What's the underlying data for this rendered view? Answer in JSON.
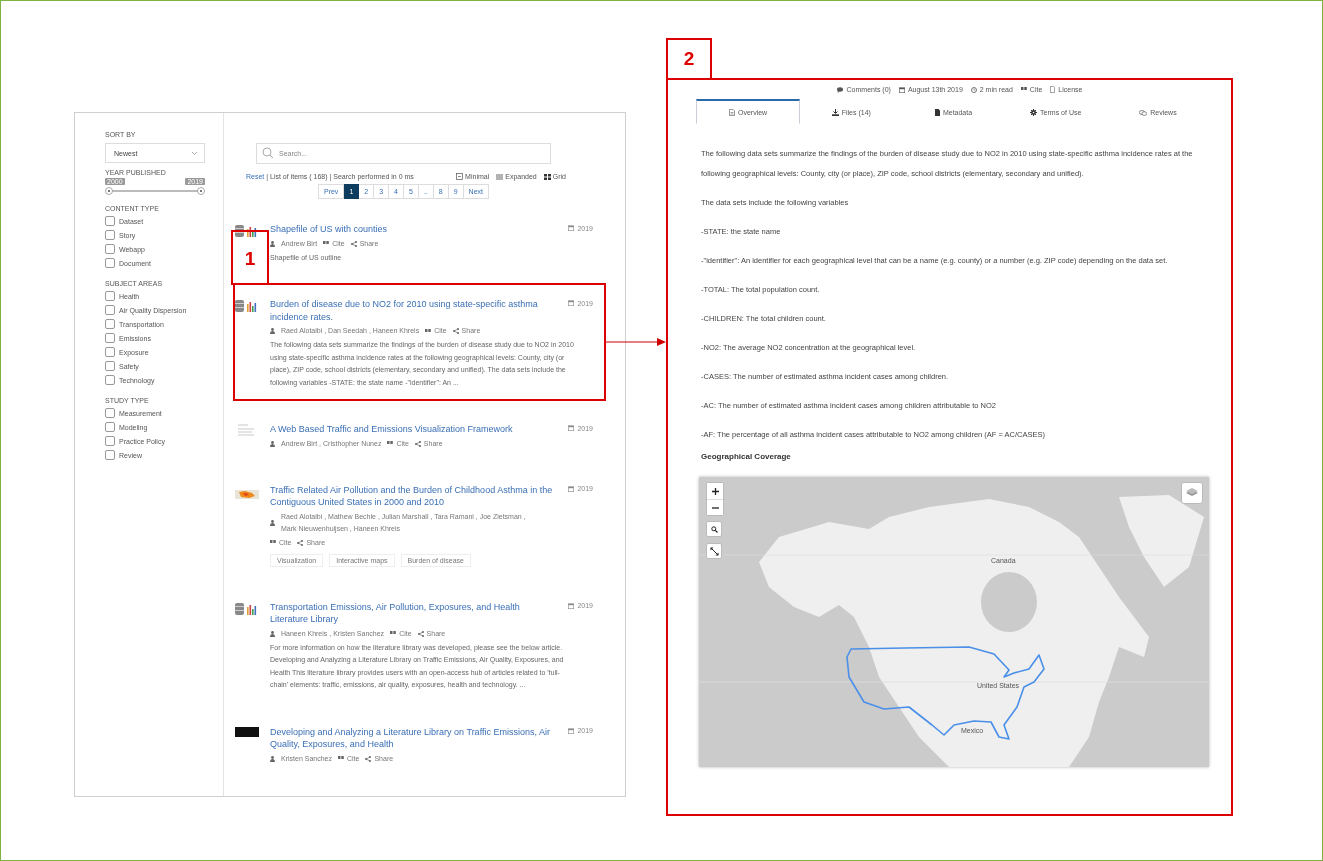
{
  "callouts": [
    {
      "label": "1"
    },
    {
      "label": "2"
    }
  ],
  "search_page": {
    "sidebar": {
      "sort_label": "SORT BY",
      "sort_value": "Newest",
      "year_label": "YEAR PUBLISHED",
      "year_from": "2000",
      "year_to": "2019",
      "year_range": {
        "level": 1
      },
      "groups": [
        {
          "title": "CONTENT TYPE",
          "options": [
            {
              "label": "Dataset",
              "checked": false
            },
            {
              "label": "Story",
              "checked": false
            },
            {
              "label": "Webapp",
              "checked": false
            },
            {
              "label": "Document",
              "checked": false
            }
          ]
        },
        {
          "title": "SUBJECT AREAS",
          "options": [
            {
              "label": "Health",
              "checked": false
            },
            {
              "label": "Air Quality Dispersion",
              "checked": false
            },
            {
              "label": "Transportation",
              "checked": false
            },
            {
              "label": "Emissions",
              "checked": false
            },
            {
              "label": "Exposure",
              "checked": false
            },
            {
              "label": "Safety",
              "checked": false
            },
            {
              "label": "Technology",
              "checked": false
            }
          ]
        },
        {
          "title": "STUDY TYPE",
          "options": [
            {
              "label": "Measurement",
              "checked": false
            },
            {
              "label": "Modeling",
              "checked": false
            },
            {
              "label": "Practice Policy",
              "checked": false
            },
            {
              "label": "Review",
              "checked": false
            }
          ]
        }
      ]
    },
    "search": {
      "placeholder": "Search..."
    },
    "info": {
      "reset": "Reset",
      "summary": "| List of items ( 168) | Search performed in 0 ms"
    },
    "views": [
      {
        "kind": "minimal",
        "label": "Minimal"
      },
      {
        "kind": "expanded",
        "label": "Expanded"
      },
      {
        "kind": "grid",
        "label": "Grid"
      }
    ],
    "pagination": [
      {
        "label": "Prev",
        "selected": false
      },
      {
        "label": "1",
        "selected": true
      },
      {
        "label": "2",
        "selected": false
      },
      {
        "label": "3",
        "selected": false
      },
      {
        "label": "4",
        "selected": false
      },
      {
        "label": "5",
        "selected": false
      },
      {
        "label": "..",
        "selected": false
      },
      {
        "label": "8",
        "selected": false
      },
      {
        "label": "9",
        "selected": false
      },
      {
        "label": "Next",
        "selected": false
      }
    ],
    "results": [
      {
        "kind": "database",
        "title": "Shapefile of US with counties",
        "year": "2019",
        "authors": "Andrew Birt",
        "cite": "Cite",
        "share": "Share",
        "description": "Shapefile of US outline"
      },
      {
        "kind": "database",
        "title": "Burden of disease due to NO2 for 2010 using state-specific asthma incidence rates.",
        "year": "2019",
        "authors": "Raed Alotaibi , Dan Seedah , Haneen Khreis",
        "cite": "Cite",
        "share": "Share",
        "description": "The following data sets summarize the findings of the burden of disease study due to NO2 in 2010 using state-specific asthma incidence rates at the following geographical levels: County, city (or place), ZIP code, school districts (elementary, secondary and unified). The data sets include the following variables -STATE: the state name -\"identifier\": An ..."
      },
      {
        "kind": "document",
        "title": "A Web Based Traffic and Emissions Visualization Framework",
        "year": "2019",
        "authors": "Andrew Birt , Cristhopher Nunez",
        "cite": "Cite",
        "share": "Share"
      },
      {
        "kind": "map",
        "title": "Traffic Related Air Pollution and the Burden of Childhood Asthma in the Contiguous United States in 2000 and 2010",
        "year": "2019",
        "authors": "Raed Alotaibi , Mathew Bechle , Julian Marshall , Tara Ramani , Joe Zietsman , Mark Nieuwenhuijsen , Haneen Khreis",
        "cite": "Cite",
        "share": "Share",
        "tags": [
          "Visualization",
          "Interactive maps",
          "Burden of disease"
        ]
      },
      {
        "kind": "database",
        "title": "Transportation Emissions, Air Pollution, Exposures, and Health Literature Library",
        "year": "2019",
        "authors": "Haneen Khreis , Kristen Sanchez",
        "cite": "Cite",
        "share": "Share",
        "description": "For more information on how the literature library was developed, please see the below article. Developing and Analyzing a Literature Library on Traffic Emissions, Air Quality, Exposures, and Health This literature library provides users with an open-access hub of articles related to 'full-chain' elements: traffic, emissions, air quality, exposures, health and technology. ..."
      },
      {
        "kind": "photo",
        "title": "Developing and Analyzing a Literature Library on Traffic Emissions, Air Quality, Exposures, and Health",
        "year": "2019",
        "authors": "Kristen Sanchez",
        "cite": "Cite",
        "share": "Share"
      }
    ]
  },
  "detail_page": {
    "meta": [
      {
        "kind": "comments",
        "text": "Comments (0)"
      },
      {
        "kind": "calendar",
        "text": "August 13th 2019"
      },
      {
        "kind": "clock",
        "text": "2 min read"
      },
      {
        "kind": "quote",
        "text": "Cite"
      },
      {
        "kind": "document",
        "text": "License"
      }
    ],
    "tabs": [
      {
        "kind": "document",
        "label": "Overview",
        "selected": true
      },
      {
        "kind": "download",
        "label": "Files (14)",
        "selected": false
      },
      {
        "kind": "file",
        "label": "Metadata",
        "selected": false
      },
      {
        "kind": "gear",
        "label": "Terms of Use",
        "selected": false
      },
      {
        "kind": "comments",
        "label": "Reviews",
        "selected": false
      }
    ],
    "paragraphs": [
      {
        "kind": "text",
        "text": "The following data sets summarize the findings of the burden of disease study due to NO2 in 2010 using state-specific asthma incidence rates at the following geographical levels: County, city (or place), ZIP code, school districts (elementary, secondary and unified)."
      },
      {
        "kind": "text",
        "text": "The data sets include the following variables"
      },
      {
        "kind": "text",
        "text": "-STATE: the state name"
      },
      {
        "kind": "text",
        "text": "-\"identifier\": An identifier for each geographical level that can be a name (e.g. county) or a number (e.g. ZIP code) depending on the data set."
      },
      {
        "kind": "text",
        "text": "-TOTAL: The total population count."
      },
      {
        "kind": "text",
        "text": "-CHILDREN: The total children count."
      },
      {
        "kind": "text",
        "text": "-NO2: The average NO2 concentration at the geographical level."
      },
      {
        "kind": "text",
        "text": "-CASES: The number of estimated asthma incident cases among children."
      },
      {
        "kind": "text",
        "text": "-AC: The number of estimated asthma incident cases among children attributable to NO2"
      },
      {
        "kind": "text",
        "text": "-AF: The percentage of all asthma incident cases attributable to NO2 among children (AF = AC/CASES)"
      },
      {
        "kind": "heading",
        "text": "Geographical Coverage"
      }
    ],
    "map": {
      "labels": [
        "Canada",
        "United States",
        "Mexico"
      ]
    }
  }
}
